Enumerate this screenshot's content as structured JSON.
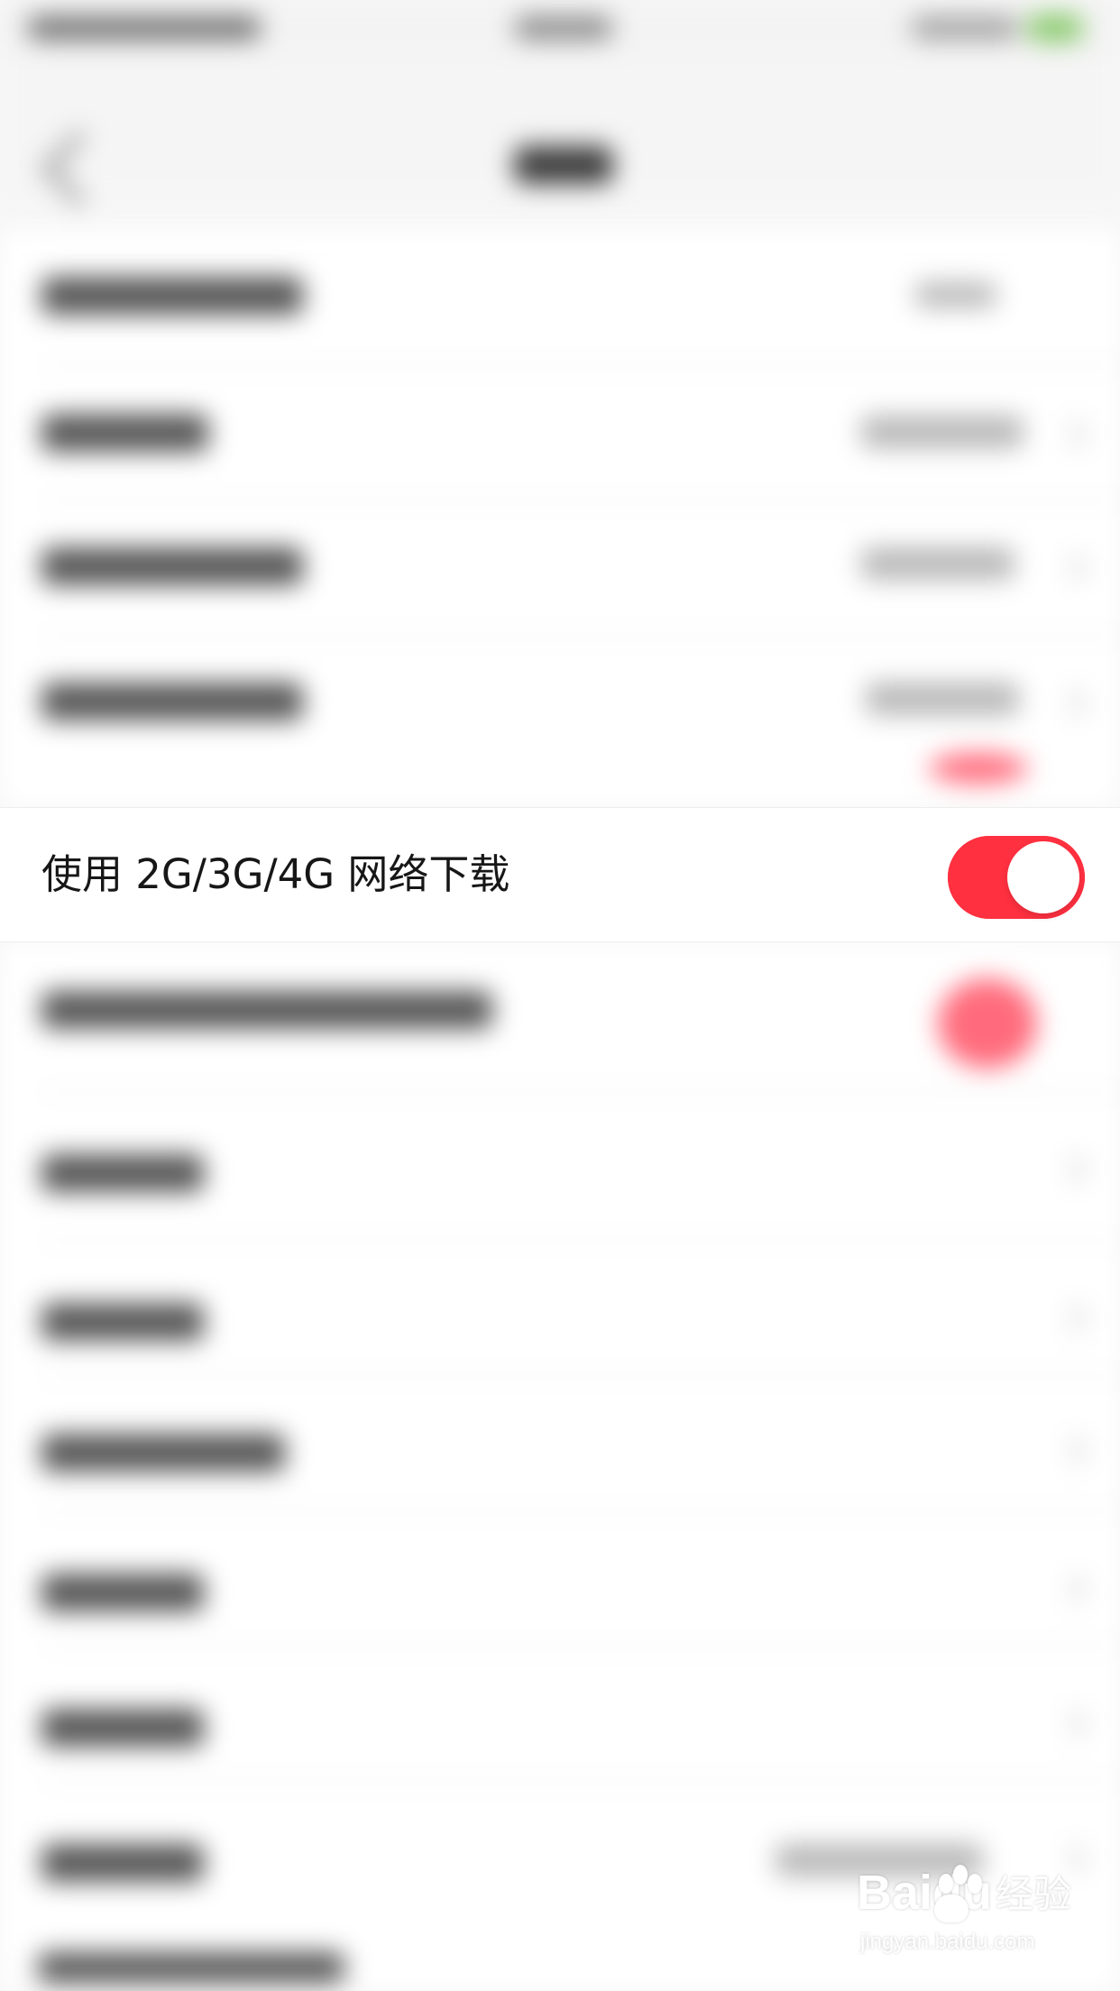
{
  "settings": {
    "highlighted_row": {
      "label": "使用 2G/3G/4G 网络下载",
      "enabled": true,
      "toggle_color": "#ff3040"
    }
  },
  "watermark": {
    "logo": "Baidu",
    "chinese": "经验",
    "domain": "jingyan.baidu.com"
  },
  "icons": {
    "back": "back-arrow-icon",
    "paw": "paw-icon"
  }
}
